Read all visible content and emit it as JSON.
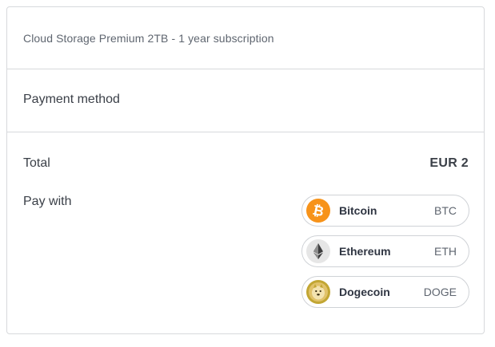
{
  "product": {
    "name": "Cloud Storage Premium 2TB - 1 year subscription"
  },
  "payment_method": {
    "title": "Payment method"
  },
  "total": {
    "label": "Total",
    "value": "EUR 2"
  },
  "pay_with": {
    "label": "Pay with",
    "coins": [
      {
        "name": "Bitcoin",
        "code": "BTC",
        "icon": "bitcoin-icon",
        "color": "#f7931a"
      },
      {
        "name": "Ethereum",
        "code": "ETH",
        "icon": "ethereum-icon",
        "color": "#3c3c3d"
      },
      {
        "name": "Dogecoin",
        "code": "DOGE",
        "icon": "dogecoin-icon",
        "color": "#c2a633"
      }
    ]
  }
}
